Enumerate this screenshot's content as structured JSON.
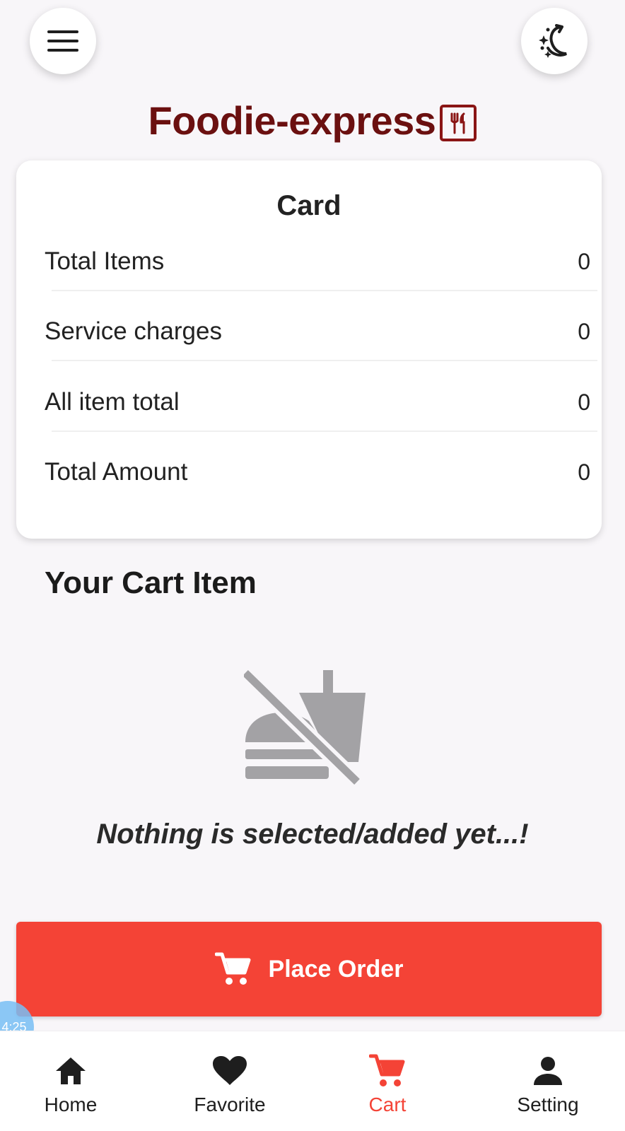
{
  "header": {
    "menu_icon": "menu-icon",
    "theme_icon": "theme-toggle-icon",
    "title": "Foodie-express",
    "title_icon": "restaurant-icon",
    "title_color": "#6b1010"
  },
  "summary_card": {
    "title": "Card",
    "rows": [
      {
        "label": "Total Items",
        "value": "0"
      },
      {
        "label": "Service charges",
        "value": "0"
      },
      {
        "label": "All item total",
        "value": "0"
      },
      {
        "label": "Total Amount",
        "value": "0"
      }
    ]
  },
  "cart": {
    "section_title": "Your Cart Item",
    "empty_icon": "no-food-icon",
    "empty_message": "Nothing is selected/added yet...!"
  },
  "place_order": {
    "label": "Place Order",
    "icon": "cart-icon",
    "color": "#f44336"
  },
  "overlay": {
    "timer_text": "4:25"
  },
  "bottom_nav": {
    "items": [
      {
        "label": "Home",
        "icon": "home-icon",
        "active": false
      },
      {
        "label": "Favorite",
        "icon": "heart-icon",
        "active": false
      },
      {
        "label": "Cart",
        "icon": "cart-icon",
        "active": true
      },
      {
        "label": "Setting",
        "icon": "person-icon",
        "active": false
      }
    ],
    "active_color": "#f44336"
  }
}
